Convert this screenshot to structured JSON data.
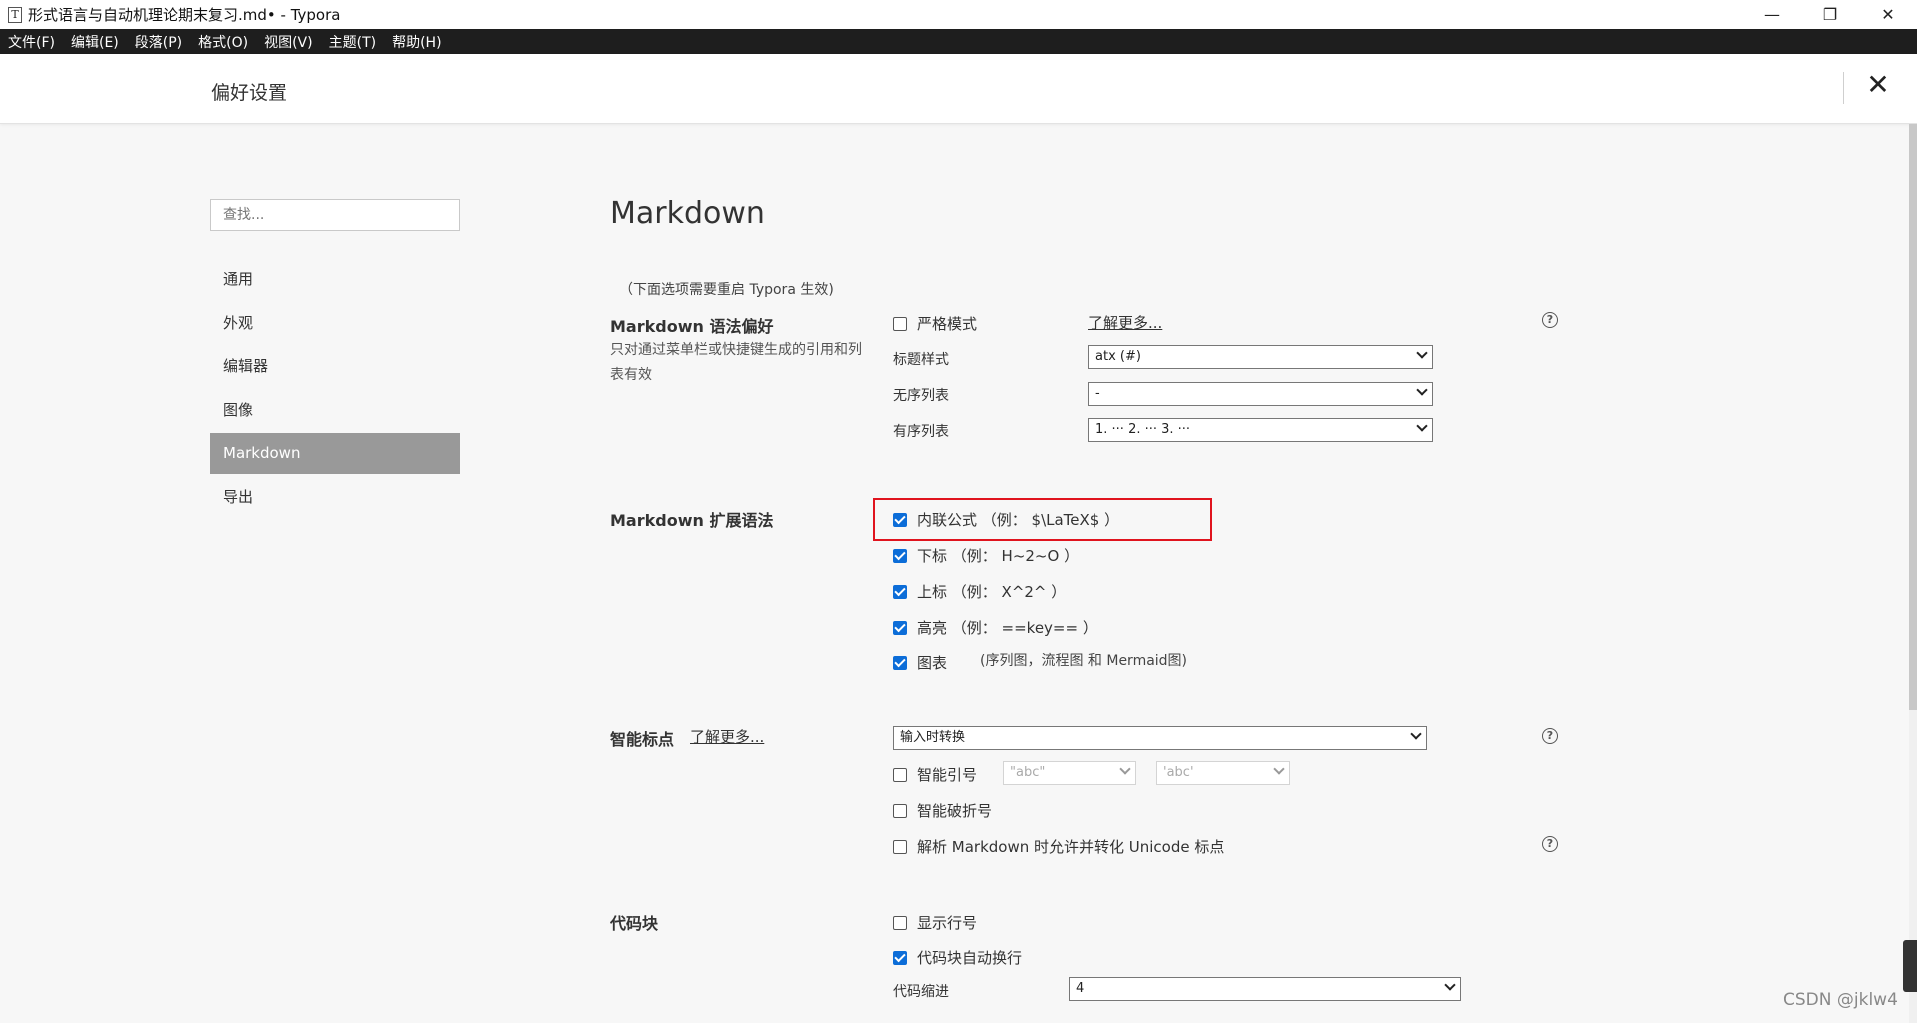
{
  "window": {
    "icon_glyph": "T",
    "title": "形式语言与自动机理论期末复习.md• - Typora",
    "minimize": "—",
    "restore": "❐",
    "close": "✕"
  },
  "menu": [
    "文件(F)",
    "编辑(E)",
    "段落(P)",
    "格式(O)",
    "视图(V)",
    "主题(T)",
    "帮助(H)"
  ],
  "prefs": {
    "title": "偏好设置",
    "close": "✕",
    "search_placeholder": "查找...",
    "nav": [
      "通用",
      "外观",
      "编辑器",
      "图像",
      "Markdown",
      "导出"
    ],
    "active_nav": "Markdown"
  },
  "page": {
    "heading": "Markdown",
    "restart_note": "（下面选项需要重启 Typora 生效)"
  },
  "syntax_pref": {
    "title": "Markdown 语法偏好",
    "desc": "只对通过菜单栏或快捷键生成的引用和列表有效",
    "strict_mode": {
      "label": "严格模式",
      "checked": false
    },
    "learn_more": "了解更多...",
    "heading_style": {
      "label": "标题样式",
      "value": "atx (#)"
    },
    "unordered_list": {
      "label": "无序列表",
      "value": "-"
    },
    "ordered_list": {
      "label": "有序列表",
      "value": "1. ··· 2. ··· 3. ···"
    }
  },
  "ext_syntax": {
    "title": "Markdown 扩展语法",
    "items": [
      {
        "label": "内联公式 （例： $\\LaTeX$ ）",
        "checked": true
      },
      {
        "label": "下标 （例： H~2~O ）",
        "checked": true
      },
      {
        "label": "上标 （例： X^2^ ）",
        "checked": true
      },
      {
        "label": "高亮 （例： ==key== ）",
        "checked": true
      },
      {
        "label": "图表",
        "checked": true
      }
    ],
    "chart_hint": "(序列图，流程图 和 Mermaid图)"
  },
  "smart_punct": {
    "title": "智能标点",
    "learn_more": "了解更多...",
    "mode": "输入时转换",
    "smart_quotes": {
      "label": "智能引号",
      "checked": false,
      "double": "\"abc\"",
      "single": "'abc'"
    },
    "smart_dashes": {
      "label": "智能破折号",
      "checked": false
    },
    "unicode_punct": {
      "label": "解析 Markdown 时允许并转化 Unicode 标点",
      "checked": false
    }
  },
  "code_block": {
    "title": "代码块",
    "line_numbers": {
      "label": "显示行号",
      "checked": false
    },
    "wrap": {
      "label": "代码块自动换行",
      "checked": true
    },
    "indent": {
      "label": "代码缩进",
      "value": "4"
    }
  },
  "watermark": "CSDN @jklw4",
  "help_glyph": "?"
}
